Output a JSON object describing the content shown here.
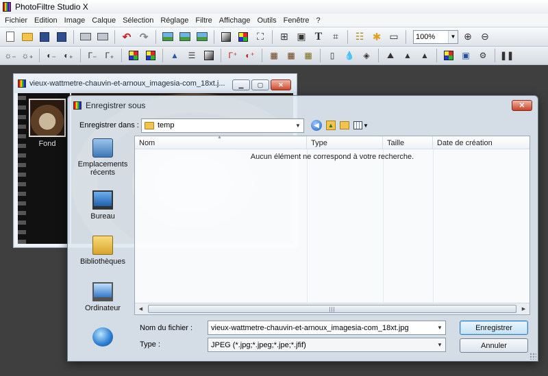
{
  "app": {
    "title": "PhotoFiltre Studio X"
  },
  "menu": {
    "items": [
      "Fichier",
      "Edition",
      "Image",
      "Calque",
      "Sélection",
      "Réglage",
      "Filtre",
      "Affichage",
      "Outils",
      "Fenêtre",
      "?"
    ]
  },
  "toolbar": {
    "zoom_value": "100%"
  },
  "image_window": {
    "title": "vieux-wattmetre-chauvin-et-arnoux_imagesia-com_18xt.j...",
    "layer_name": "Fond"
  },
  "dialog": {
    "title": "Enregistrer sous",
    "close_glyph": "✕",
    "save_in_label": "Enregistrer dans :",
    "save_in_value": "temp",
    "places": [
      {
        "label": "Emplacements récents",
        "icon": "recent-places-icon"
      },
      {
        "label": "Bureau",
        "icon": "desktop-icon"
      },
      {
        "label": "Bibliothèques",
        "icon": "libraries-icon"
      },
      {
        "label": "Ordinateur",
        "icon": "computer-icon"
      },
      {
        "label": "",
        "icon": "network-icon"
      }
    ],
    "columns": [
      "Nom",
      "Type",
      "Taille",
      "Date de création"
    ],
    "empty_message": "Aucun élément ne correspond à votre recherche.",
    "filename_label": "Nom du fichier :",
    "filename_value": "vieux-wattmetre-chauvin-et-arnoux_imagesia-com_18xt.jpg",
    "type_label": "Type :",
    "type_value": "JPEG (*.jpg;*.jpeg;*.jpe;*.jfif)",
    "save_button": "Enregistrer",
    "cancel_button": "Annuler"
  }
}
